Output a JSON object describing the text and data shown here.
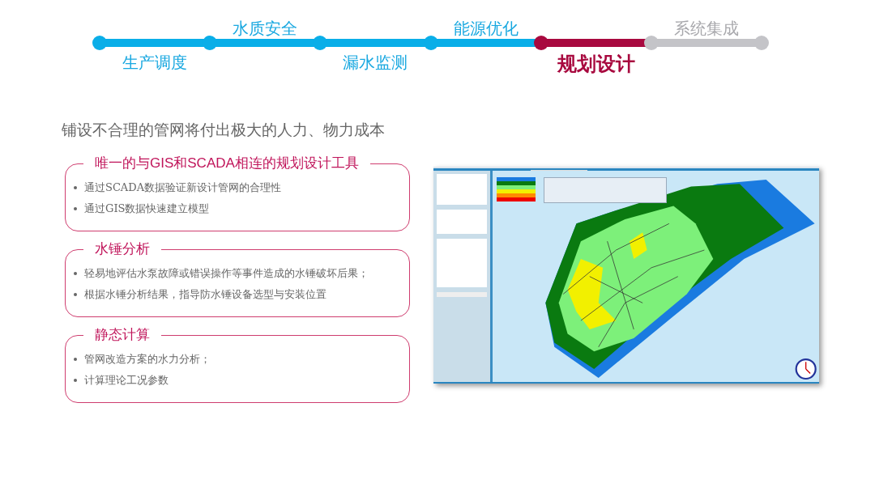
{
  "timeline": [
    {
      "label": "生产调度",
      "label_above": false,
      "completed": true,
      "selected": false
    },
    {
      "label": "水质安全",
      "label_above": true,
      "completed": true,
      "selected": false
    },
    {
      "label": "漏水监测",
      "label_above": false,
      "completed": true,
      "selected": false
    },
    {
      "label": "能源优化",
      "label_above": true,
      "completed": true,
      "selected": false
    },
    {
      "label": "规划设计",
      "label_above": false,
      "completed": false,
      "selected": true
    },
    {
      "label": "系统集成",
      "label_above": true,
      "completed": false,
      "selected": false
    }
  ],
  "subtitle": "铺设不合理的管网将付出极大的人力、物力成本",
  "sections": [
    {
      "title": "唯一的与GIS和SCADA相连的规划设计工具",
      "bullets": [
        "通过SCADA数据验证新设计管网的合理性",
        "通过GIS数据快速建立模型"
      ]
    },
    {
      "title": "水锤分析",
      "bullets": [
        "轻易地评估水泵故障或错误操作等事件造成的水锤破坏后果；",
        "根据水锤分析结果，指导防水锤设备选型与安装位置"
      ]
    },
    {
      "title": "静态计算",
      "bullets": [
        "管网改造方案的水力分析；",
        "计算理论工况参数"
      ]
    }
  ]
}
